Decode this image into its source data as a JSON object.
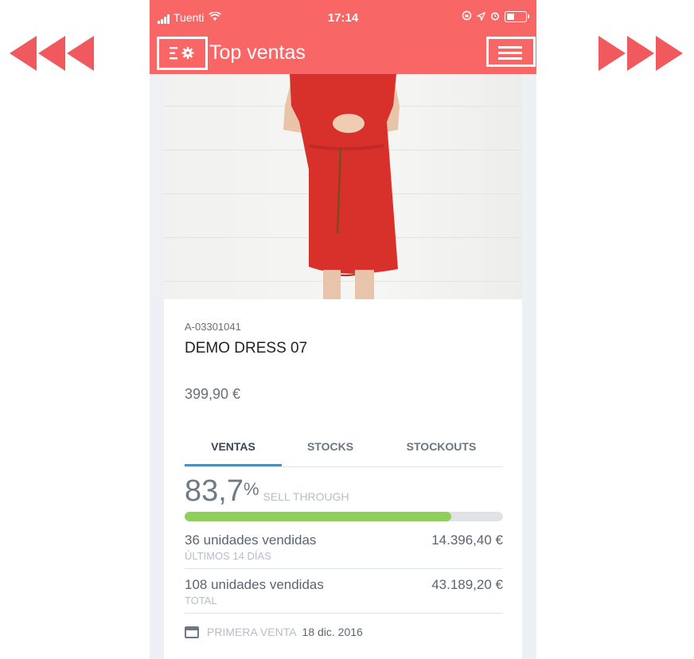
{
  "status_bar": {
    "carrier": "Tuenti",
    "time": "17:14",
    "icons": [
      "signal-icon",
      "wifi-icon",
      "rotation-lock-icon",
      "location-icon",
      "alarm-icon",
      "battery-icon"
    ]
  },
  "header": {
    "title": "Top ventas",
    "left_button_icon": "filter-settings-icon",
    "right_button_icon": "hamburger-menu-icon",
    "background_color": "#f86666"
  },
  "product": {
    "sku": "A-03301041",
    "name": "DEMO DRESS 07",
    "price": "399,90 €"
  },
  "tabs": [
    {
      "label": "VENTAS",
      "active": true
    },
    {
      "label": "STOCKS",
      "active": false
    },
    {
      "label": "STOCKOUTS",
      "active": false
    }
  ],
  "sell_through": {
    "value": "83,7",
    "unit": "%",
    "label": "SELL THROUGH",
    "progress": 0.837,
    "bar_color": "#8fcf5b"
  },
  "sales_rows": [
    {
      "units": "36 unidades vendidas",
      "period": "ÚLTIMOS 14 DÍAS",
      "amount": "14.396,40 €"
    },
    {
      "units": "108 unidades vendidas",
      "period": "TOTAL",
      "amount": "43.189,20 €"
    }
  ],
  "first_sale": {
    "label": "PRIMERA VENTA",
    "date": "18 dic. 2016"
  },
  "nav_arrows": {
    "left_icon": "rewind-arrows-icon",
    "right_icon": "forward-arrows-icon",
    "color": "#f0595d"
  }
}
